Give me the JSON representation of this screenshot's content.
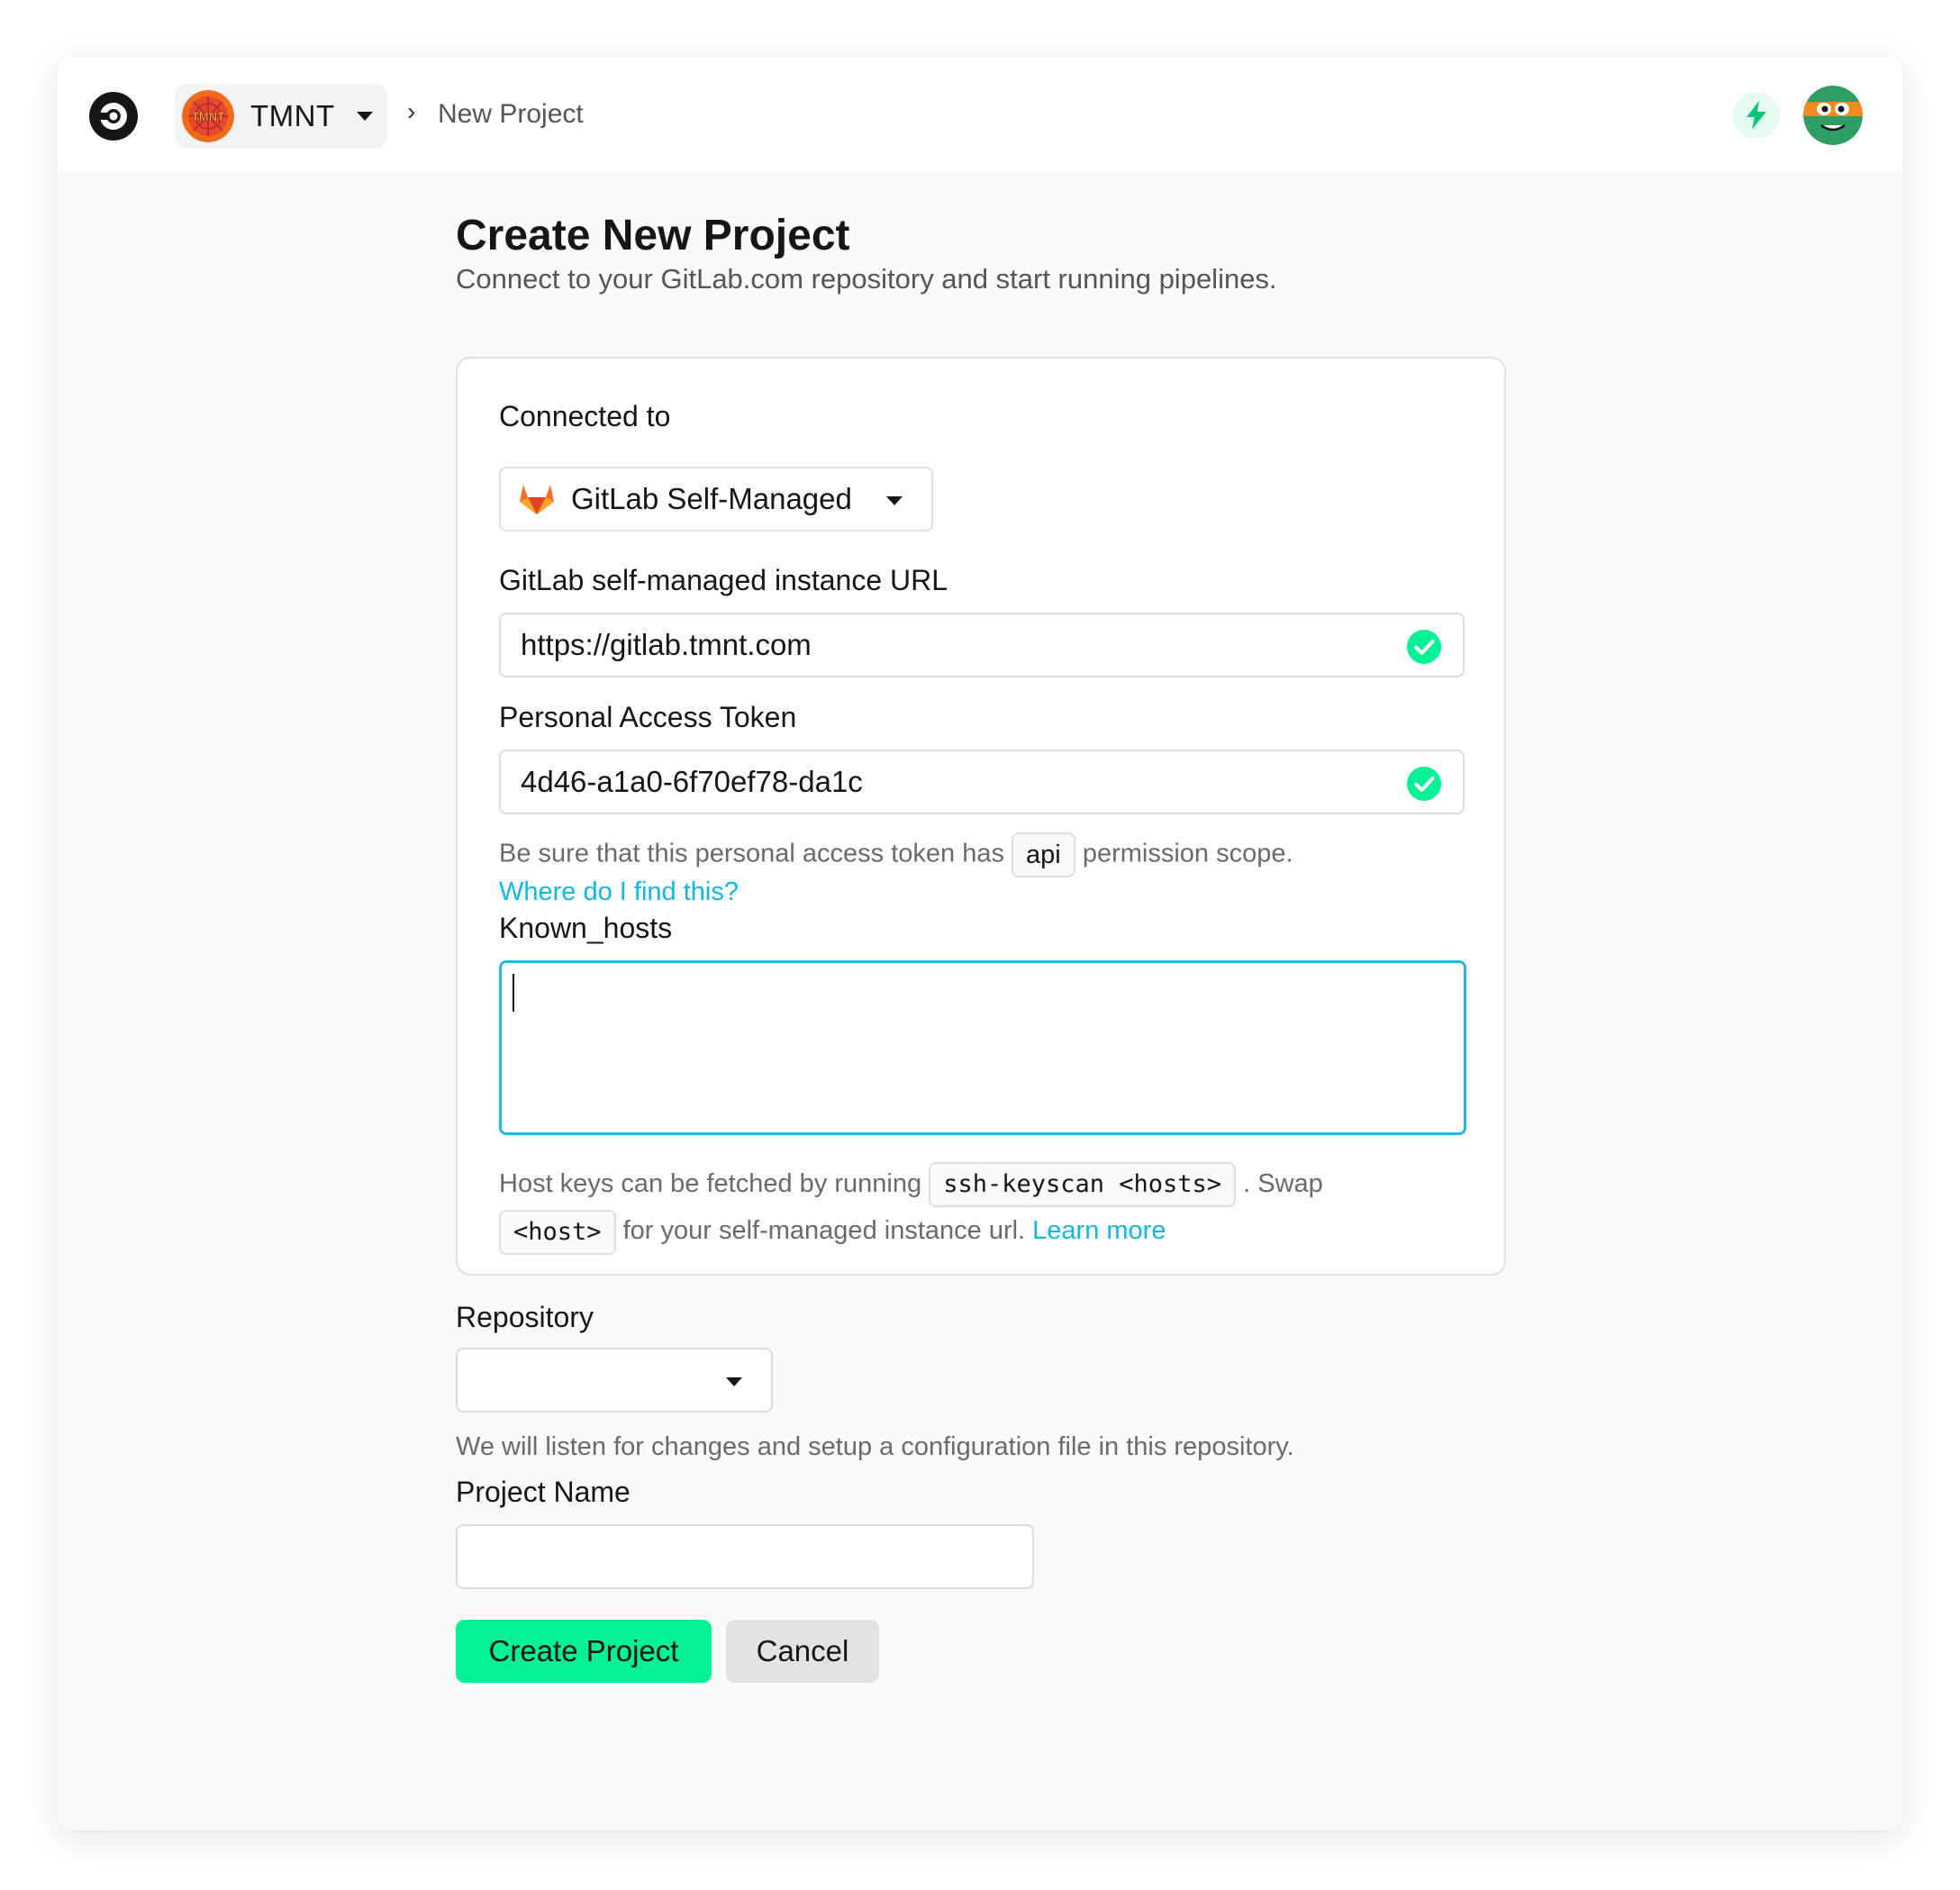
{
  "header": {
    "org": {
      "name": "TMNT",
      "avatar_text": "TMNT"
    },
    "breadcrumb": {
      "separator": "›",
      "current": "New Project"
    }
  },
  "page": {
    "title": "Create New Project",
    "subtitle": "Connect to your GitLab.com repository and start running pipelines."
  },
  "form": {
    "connected_to": {
      "label": "Connected to",
      "value": "GitLab Self-Managed",
      "icon": "gitlab-icon"
    },
    "instance_url": {
      "label": "GitLab self-managed instance URL",
      "value": "https://gitlab.tmnt.com",
      "status": "valid"
    },
    "token": {
      "label": "Personal Access Token",
      "value": "4d46-a1a0-6f70ef78-da1c",
      "status": "valid",
      "help_before": "Be sure that this personal access token has",
      "help_code": "api",
      "help_after": "permission scope.",
      "help_link": "Where do I find this?"
    },
    "known_hosts": {
      "label": "Known_hosts",
      "value": "",
      "help_part1": "Host keys can be fetched by running",
      "help_code1": "ssh-keyscan <hosts>",
      "help_part2": ". Swap",
      "help_code2": "<host>",
      "help_part3": "for your self-managed instance url.",
      "help_link": "Learn more"
    },
    "repository": {
      "label": "Repository",
      "value": "",
      "help": "We will listen for changes and setup a configuration file in this repository."
    },
    "project_name": {
      "label": "Project Name",
      "value": ""
    }
  },
  "actions": {
    "create": "Create Project",
    "cancel": "Cancel"
  },
  "colors": {
    "accent": "#04f094",
    "link": "#0fb7e6",
    "focus": "#25b8e4",
    "success": "#04f094"
  }
}
